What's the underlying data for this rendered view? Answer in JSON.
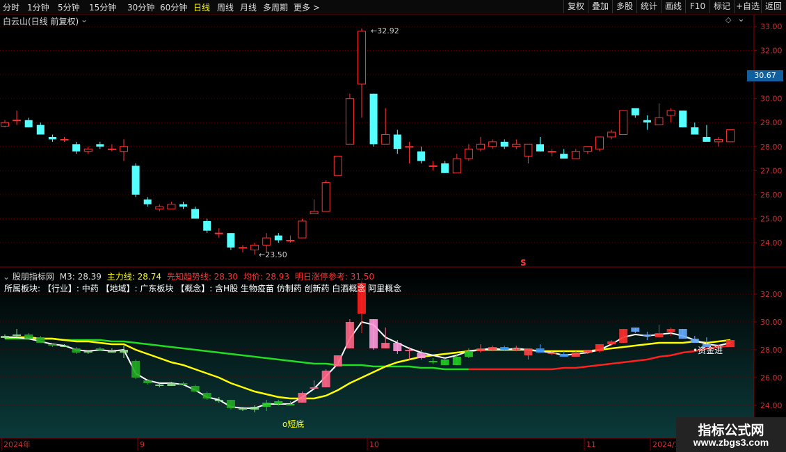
{
  "toolbar": {
    "periods": [
      "分时",
      "1分钟",
      "5分钟",
      "15分钟",
      "30分钟",
      "60分钟",
      "日线",
      "周线",
      "月线",
      "多周期",
      "更多 >"
    ],
    "active_period": "日线",
    "buttons": [
      "复权",
      "叠加",
      "多股",
      "统计",
      "画线",
      "F10",
      "标记",
      "+自选",
      "返回"
    ]
  },
  "main_panel": {
    "title": "白云山(日线 前复权)",
    "high_label": "32.92",
    "low_label": "23.50",
    "current_price": "30.67",
    "signal_mark": "S",
    "yaxis_ticks": [
      "33.00",
      "32.00",
      "31.00",
      "30.00",
      "29.00",
      "28.00",
      "27.00",
      "26.00",
      "25.00",
      "24.00"
    ]
  },
  "indicator_panel": {
    "title": "股朋指标网",
    "m3_text": "M3: 28.39",
    "main_line_text": "主力线: 28.74",
    "trend_line_text": "先知趋势线: 28.30",
    "avg_price_text": "均价: 28.93",
    "limit_up_text": "明日涨停参考: 31.50",
    "sector_text": "所属板块: 【行业】: 中药 【地域】: 广东板块 【概念】: 含H股 生物疫苗 仿制药 创新药 白酒概念 阿里概念",
    "short_bottom_label": "o短底",
    "fund_in_label": "资金进",
    "yaxis_ticks": [
      "32.00",
      "30.00",
      "28.00",
      "26.00",
      "24.00"
    ]
  },
  "time_axis": {
    "labels": [
      "2024年",
      "9",
      "10",
      "11",
      "2024/1"
    ]
  },
  "watermark": {
    "line1": "指标公式网",
    "line2": "www.zbgs3.com"
  },
  "colors": {
    "up": "#ff3232",
    "down": "#54ffff",
    "yellow": "#ffff00",
    "green": "#22dd22",
    "red_line": "#ff2020",
    "axis": "#8b0000"
  },
  "chart_data": {
    "type": "candlestick",
    "candles": [
      {
        "o": 28.85,
        "h": 29.1,
        "l": 28.8,
        "c": 29.0
      },
      {
        "o": 29.1,
        "h": 29.5,
        "l": 28.9,
        "c": 29.1
      },
      {
        "o": 29.1,
        "h": 29.2,
        "l": 28.8,
        "c": 28.8
      },
      {
        "o": 28.9,
        "h": 29.0,
        "l": 28.5,
        "c": 28.5
      },
      {
        "o": 28.4,
        "h": 28.5,
        "l": 28.2,
        "c": 28.3
      },
      {
        "o": 28.3,
        "h": 28.4,
        "l": 28.2,
        "c": 28.3
      },
      {
        "o": 28.1,
        "h": 28.2,
        "l": 27.7,
        "c": 27.8
      },
      {
        "o": 27.8,
        "h": 28.0,
        "l": 27.7,
        "c": 27.9
      },
      {
        "o": 28.1,
        "h": 28.2,
        "l": 27.9,
        "c": 28.0
      },
      {
        "o": 27.9,
        "h": 28.1,
        "l": 27.8,
        "c": 27.9
      },
      {
        "o": 27.8,
        "h": 28.3,
        "l": 27.4,
        "c": 28.0
      },
      {
        "o": 27.2,
        "h": 27.3,
        "l": 25.9,
        "c": 26.0
      },
      {
        "o": 25.8,
        "h": 25.9,
        "l": 25.5,
        "c": 25.6
      },
      {
        "o": 25.4,
        "h": 25.6,
        "l": 25.3,
        "c": 25.5
      },
      {
        "o": 25.4,
        "h": 25.7,
        "l": 25.4,
        "c": 25.6
      },
      {
        "o": 25.6,
        "h": 25.7,
        "l": 25.4,
        "c": 25.5
      },
      {
        "o": 25.4,
        "h": 25.5,
        "l": 25.0,
        "c": 25.0
      },
      {
        "o": 24.9,
        "h": 25.0,
        "l": 24.4,
        "c": 24.5
      },
      {
        "o": 24.4,
        "h": 24.6,
        "l": 24.2,
        "c": 24.4
      },
      {
        "o": 24.4,
        "h": 24.4,
        "l": 23.7,
        "c": 23.8
      },
      {
        "o": 23.8,
        "h": 23.9,
        "l": 23.6,
        "c": 23.8
      },
      {
        "o": 23.7,
        "h": 24.0,
        "l": 23.5,
        "c": 23.9
      },
      {
        "o": 23.9,
        "h": 24.4,
        "l": 23.6,
        "c": 24.2
      },
      {
        "o": 24.3,
        "h": 24.4,
        "l": 24.0,
        "c": 24.1
      },
      {
        "o": 24.1,
        "h": 24.3,
        "l": 24.0,
        "c": 24.1
      },
      {
        "o": 24.2,
        "h": 25.0,
        "l": 24.2,
        "c": 24.9
      },
      {
        "o": 25.2,
        "h": 25.8,
        "l": 25.2,
        "c": 25.3
      },
      {
        "o": 25.3,
        "h": 26.6,
        "l": 25.3,
        "c": 26.5
      },
      {
        "o": 26.8,
        "h": 27.6,
        "l": 26.8,
        "c": 27.6
      },
      {
        "o": 28.1,
        "h": 30.2,
        "l": 28.1,
        "c": 30.0
      },
      {
        "o": 30.6,
        "h": 32.92,
        "l": 29.2,
        "c": 32.8
      },
      {
        "o": 30.2,
        "h": 30.2,
        "l": 28.0,
        "c": 28.1
      },
      {
        "o": 28.1,
        "h": 29.6,
        "l": 28.1,
        "c": 28.5
      },
      {
        "o": 28.5,
        "h": 28.7,
        "l": 27.7,
        "c": 27.9
      },
      {
        "o": 28.0,
        "h": 28.2,
        "l": 27.3,
        "c": 28.0
      },
      {
        "o": 27.8,
        "h": 28.0,
        "l": 27.3,
        "c": 27.4
      },
      {
        "o": 27.2,
        "h": 27.4,
        "l": 27.0,
        "c": 27.2
      },
      {
        "o": 27.3,
        "h": 27.4,
        "l": 26.9,
        "c": 26.9
      },
      {
        "o": 26.9,
        "h": 27.7,
        "l": 26.9,
        "c": 27.5
      },
      {
        "o": 27.5,
        "h": 28.1,
        "l": 27.4,
        "c": 27.9
      },
      {
        "o": 27.9,
        "h": 28.4,
        "l": 27.8,
        "c": 28.1
      },
      {
        "o": 28.0,
        "h": 28.3,
        "l": 27.9,
        "c": 28.2
      },
      {
        "o": 28.2,
        "h": 28.3,
        "l": 27.9,
        "c": 28.0
      },
      {
        "o": 28.0,
        "h": 28.3,
        "l": 27.9,
        "c": 28.1
      },
      {
        "o": 27.6,
        "h": 28.1,
        "l": 27.3,
        "c": 28.1
      },
      {
        "o": 28.1,
        "h": 28.4,
        "l": 27.8,
        "c": 27.8
      },
      {
        "o": 27.8,
        "h": 27.9,
        "l": 27.6,
        "c": 27.8
      },
      {
        "o": 27.7,
        "h": 27.9,
        "l": 27.5,
        "c": 27.5
      },
      {
        "o": 27.5,
        "h": 27.9,
        "l": 27.5,
        "c": 27.8
      },
      {
        "o": 27.8,
        "h": 28.0,
        "l": 27.7,
        "c": 28.0
      },
      {
        "o": 27.9,
        "h": 28.4,
        "l": 27.8,
        "c": 28.4
      },
      {
        "o": 28.4,
        "h": 28.7,
        "l": 28.3,
        "c": 28.6
      },
      {
        "o": 28.5,
        "h": 29.5,
        "l": 28.5,
        "c": 29.5
      },
      {
        "o": 29.6,
        "h": 29.6,
        "l": 29.2,
        "c": 29.3
      },
      {
        "o": 29.1,
        "h": 29.3,
        "l": 28.7,
        "c": 29.0
      },
      {
        "o": 28.9,
        "h": 29.8,
        "l": 28.9,
        "c": 29.2
      },
      {
        "o": 29.3,
        "h": 29.6,
        "l": 29.0,
        "c": 29.5
      },
      {
        "o": 29.5,
        "h": 29.5,
        "l": 28.8,
        "c": 28.8
      },
      {
        "o": 28.8,
        "h": 29.0,
        "l": 28.5,
        "c": 28.5
      },
      {
        "o": 28.4,
        "h": 28.9,
        "l": 28.2,
        "c": 28.2
      },
      {
        "o": 28.2,
        "h": 28.4,
        "l": 28.0,
        "c": 28.3
      },
      {
        "o": 28.2,
        "h": 28.7,
        "l": 28.2,
        "c": 28.7
      }
    ],
    "ind_white": [
      28.9,
      28.9,
      28.8,
      28.6,
      28.4,
      28.3,
      28.0,
      27.9,
      28.0,
      27.9,
      28.0,
      26.3,
      25.8,
      25.6,
      25.6,
      25.5,
      25.1,
      24.6,
      24.4,
      23.9,
      23.8,
      23.8,
      24.1,
      24.1,
      24.1,
      24.6,
      25.2,
      26.1,
      27.0,
      28.8,
      30.0,
      29.8,
      28.9,
      28.5,
      28.1,
      27.8,
      27.6,
      27.4,
      27.6,
      27.9,
      28.0,
      28.1,
      28.0,
      28.1,
      28.0,
      27.9,
      27.8,
      27.6,
      27.7,
      27.8,
      28.0,
      28.4,
      28.9,
      29.1,
      29.0,
      29.1,
      29.2,
      29.0,
      28.7,
      28.4,
      28.3,
      28.5
    ],
    "ind_yellow": [
      28.9,
      28.9,
      28.9,
      28.8,
      28.8,
      28.7,
      28.6,
      28.6,
      28.5,
      28.4,
      28.4,
      28.0,
      27.7,
      27.4,
      27.1,
      26.9,
      26.6,
      26.3,
      26.0,
      25.6,
      25.3,
      25.0,
      24.8,
      24.6,
      24.5,
      24.5,
      24.5,
      24.7,
      25.1,
      25.6,
      26.0,
      26.4,
      26.8,
      27.1,
      27.3,
      27.5,
      27.6,
      27.7,
      27.8,
      27.9,
      28.0,
      28.0,
      28.0,
      28.0,
      28.0,
      27.9,
      27.9,
      27.9,
      27.9,
      27.9,
      28.0,
      28.1,
      28.2,
      28.3,
      28.4,
      28.5,
      28.5,
      28.5,
      28.6,
      28.5,
      28.6,
      28.7
    ],
    "ind_green": [
      28.8,
      28.8,
      28.8,
      28.8,
      28.8,
      28.7,
      28.7,
      28.7,
      28.7,
      28.6,
      28.6,
      28.5,
      28.4,
      28.3,
      28.2,
      28.1,
      28.0,
      27.9,
      27.8,
      27.7,
      27.6,
      27.5,
      27.4,
      27.3,
      27.2,
      27.1,
      27.0,
      27.0,
      26.9,
      26.9,
      26.9,
      26.8,
      26.8,
      26.8,
      26.8,
      26.7,
      26.7,
      26.6,
      26.6,
      26.6
    ],
    "ind_red": [
      26.6,
      26.6,
      26.6,
      26.6,
      26.6,
      26.6,
      26.6,
      26.6,
      26.7,
      26.7,
      26.8,
      26.9,
      27.0,
      27.1,
      27.2,
      27.3,
      27.5,
      27.6,
      27.8,
      27.9,
      28.1,
      28.2,
      28.3
    ]
  }
}
